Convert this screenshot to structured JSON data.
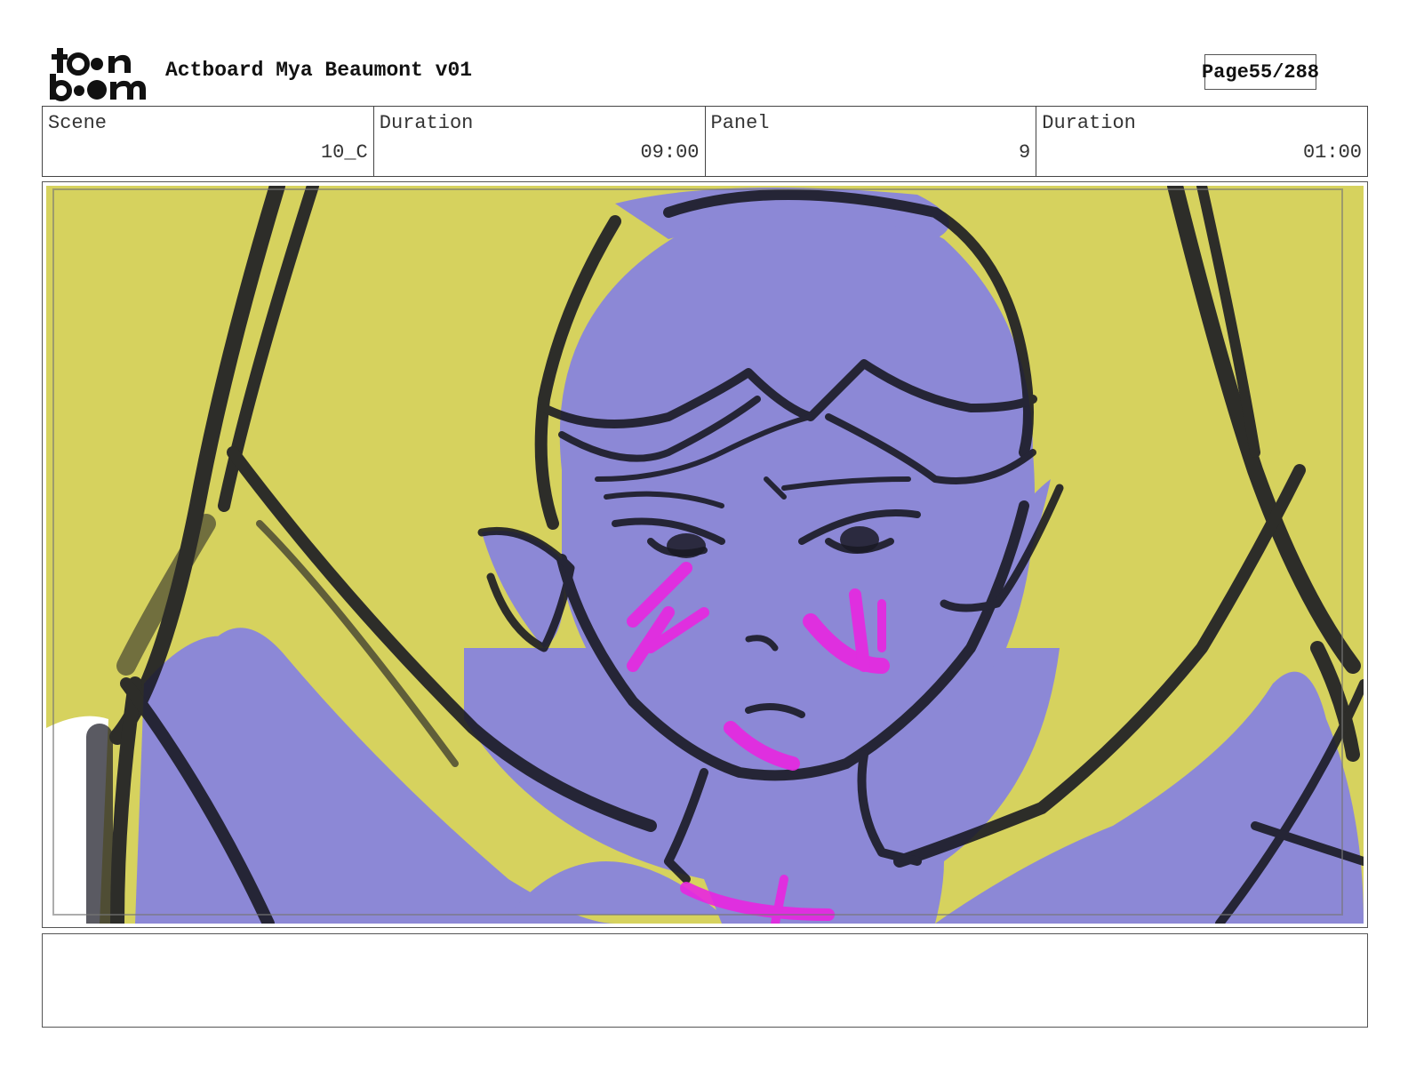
{
  "header": {
    "logo_name": "toon boom",
    "project_title": "Actboard Mya Beaumont v01",
    "page_label": "Page",
    "page_value": "55/288"
  },
  "info": {
    "scene_label": "Scene",
    "scene_value": "10_C",
    "scene_duration_label": "Duration",
    "scene_duration_value": "09:00",
    "panel_label": "Panel",
    "panel_value": "9",
    "panel_duration_label": "Duration",
    "panel_duration_value": "01:00"
  },
  "panel": {
    "colors": {
      "background": "#d6d25e",
      "skin": "#8c88d6",
      "ink": "#1a1a24",
      "blush": "#e826e0"
    }
  },
  "notes": {
    "text": ""
  }
}
